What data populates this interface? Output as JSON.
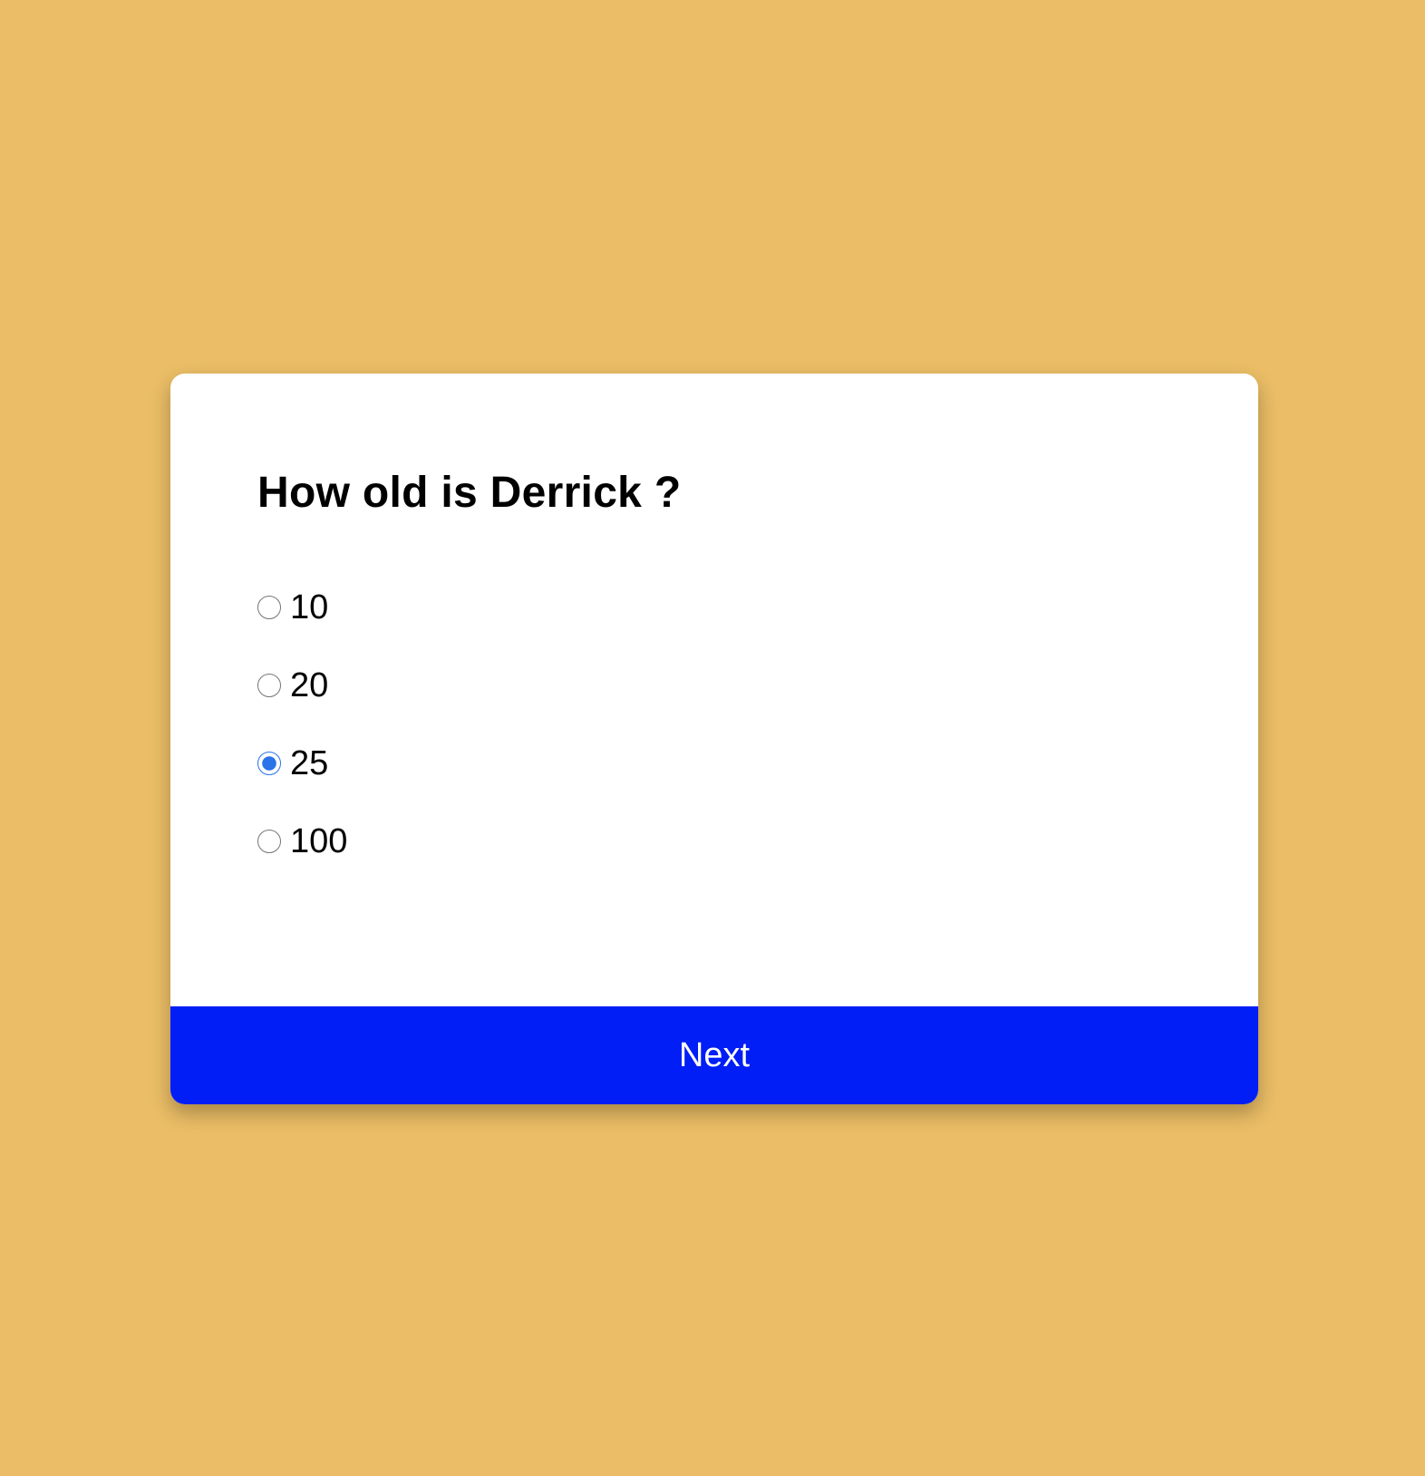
{
  "theme": {
    "background": "#EABD66",
    "card": "#FFFFFF",
    "button": "#001EF5",
    "selected_radio": "#2A73E8"
  },
  "quiz": {
    "question": "How old is Derrick ?",
    "answers": [
      {
        "label": "10",
        "selected": false
      },
      {
        "label": "20",
        "selected": false
      },
      {
        "label": "25",
        "selected": true
      },
      {
        "label": "100",
        "selected": false
      }
    ],
    "submit_label": "Next"
  }
}
